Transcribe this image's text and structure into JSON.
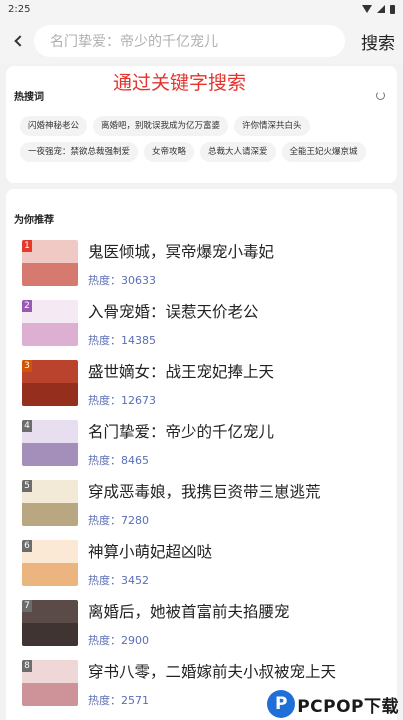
{
  "status_bar": {
    "time": "2:25"
  },
  "search": {
    "placeholder": "名门挚爱：帝少的千亿宠儿",
    "button_label": "搜索"
  },
  "overlay_caption": "通过关键字搜索",
  "hot_words": {
    "title": "热搜词",
    "tags": [
      "闪婚神秘老公",
      "离婚吧，别耽误我成为亿万富婆",
      "许你情深共白头",
      "一夜强宠：禁欲总裁强制爱",
      "女帝攻略",
      "总裁大人请深爱",
      "全能王妃火爆京城"
    ]
  },
  "recommend": {
    "title": "为你推荐",
    "heat_prefix": "热度：",
    "books": [
      {
        "rank": "1",
        "name": "鬼医倾城，冥帝爆宠小毒妃",
        "heat": "30633",
        "rank_color": "#e23b2d",
        "cover_color": "#f1c9c4",
        "art_color": "#c0392b"
      },
      {
        "rank": "2",
        "name": "入骨宠婚：误惹天价老公",
        "heat": "14385",
        "rank_color": "#9b59b6",
        "cover_color": "#f5eaf4",
        "art_color": "#c97fb8"
      },
      {
        "rank": "3",
        "name": "盛世嫡女：战王宠妃捧上天",
        "heat": "12673",
        "rank_color": "#d35400",
        "cover_color": "#b9432c",
        "art_color": "#7a1e12"
      },
      {
        "rank": "4",
        "name": "名门挚爱：帝少的千亿宠儿",
        "heat": "8465",
        "rank_color": "#6c6c6c",
        "cover_color": "#e7def0",
        "art_color": "#6b4e8c"
      },
      {
        "rank": "5",
        "name": "穿成恶毒娘，我携巨资带三崽逃荒",
        "heat": "7280",
        "rank_color": "#6c6c6c",
        "cover_color": "#f2ead7",
        "art_color": "#8a6f3c"
      },
      {
        "rank": "6",
        "name": "神算小萌妃超凶哒",
        "heat": "3452",
        "rank_color": "#6c6c6c",
        "cover_color": "#fbe9d6",
        "art_color": "#e08a3b"
      },
      {
        "rank": "7",
        "name": "离婚后，她被首富前夫掐腰宠",
        "heat": "2900",
        "rank_color": "#6c6c6c",
        "cover_color": "#5a4a48",
        "art_color": "#2b2220"
      },
      {
        "rank": "8",
        "name": "穿书八零，二婚嫁前夫小叔被宠上天",
        "heat": "2571",
        "rank_color": "#6c6c6c",
        "cover_color": "#f0d7d7",
        "art_color": "#b35a66"
      }
    ]
  },
  "watermark": {
    "logo_letter": "P",
    "text": "PCPOP下载"
  }
}
